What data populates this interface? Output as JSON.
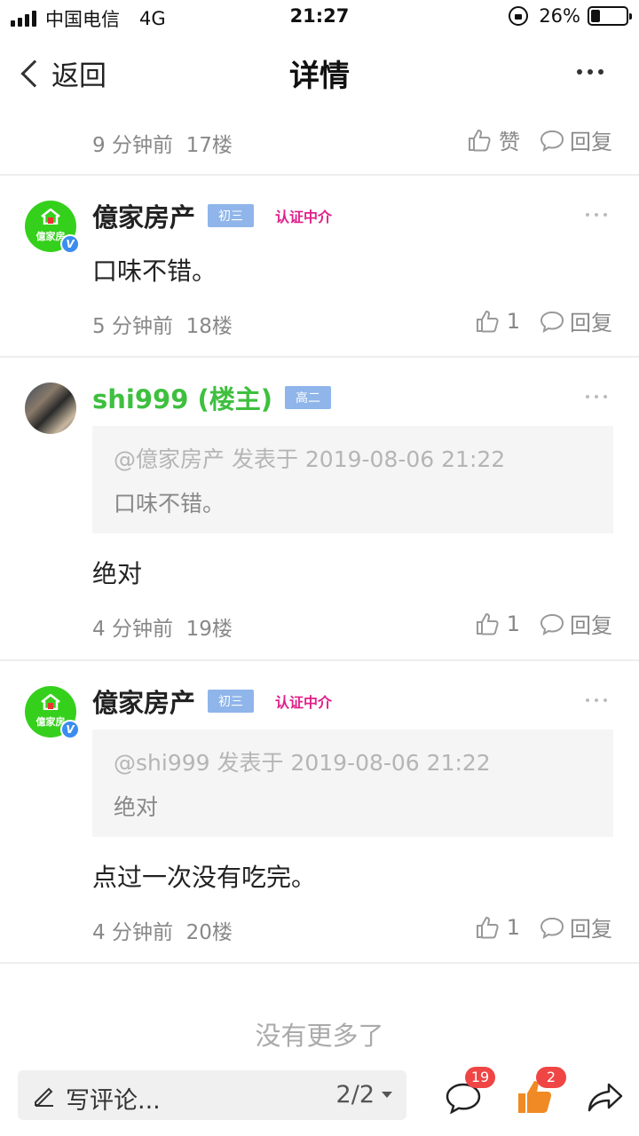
{
  "status_bar": {
    "carrier": "中国电信",
    "network": "4G",
    "time": "21:27",
    "battery_percent": "26%",
    "battery_level": 0.26
  },
  "nav": {
    "back_label": "返回",
    "title": "详情"
  },
  "top_meta": {
    "time": "9 分钟前",
    "floor": "17楼",
    "like_label": "赞",
    "reply_label": "回复"
  },
  "posts": [
    {
      "name": "億家房产",
      "level": "初三",
      "cert": "认证中介",
      "avatar_text": "億家房",
      "content": "口味不错。",
      "time": "5 分钟前",
      "floor": "18楼",
      "likes": "1",
      "reply_label": "回复"
    },
    {
      "name": "shi999 (楼主)",
      "level": "高二",
      "quote_head": "@億家房产 发表于 2019-08-06 21:22",
      "quote_body": "口味不错。",
      "content": "绝对",
      "time": "4 分钟前",
      "floor": "19楼",
      "likes": "1",
      "reply_label": "回复"
    },
    {
      "name": "億家房产",
      "level": "初三",
      "cert": "认证中介",
      "avatar_text": "億家房",
      "quote_head": "@shi999 发表于 2019-08-06 21:22",
      "quote_body": "绝对",
      "content": "点过一次没有吃完。",
      "time": "4 分钟前",
      "floor": "20楼",
      "likes": "1",
      "reply_label": "回复"
    }
  ],
  "no_more": "没有更多了",
  "bottom_bar": {
    "write_placeholder": "写评论...",
    "page_indicator": "2/2",
    "comment_count": "19",
    "like_count": "2",
    "accent_color": "#f08a24",
    "badge_color": "#f04545"
  }
}
